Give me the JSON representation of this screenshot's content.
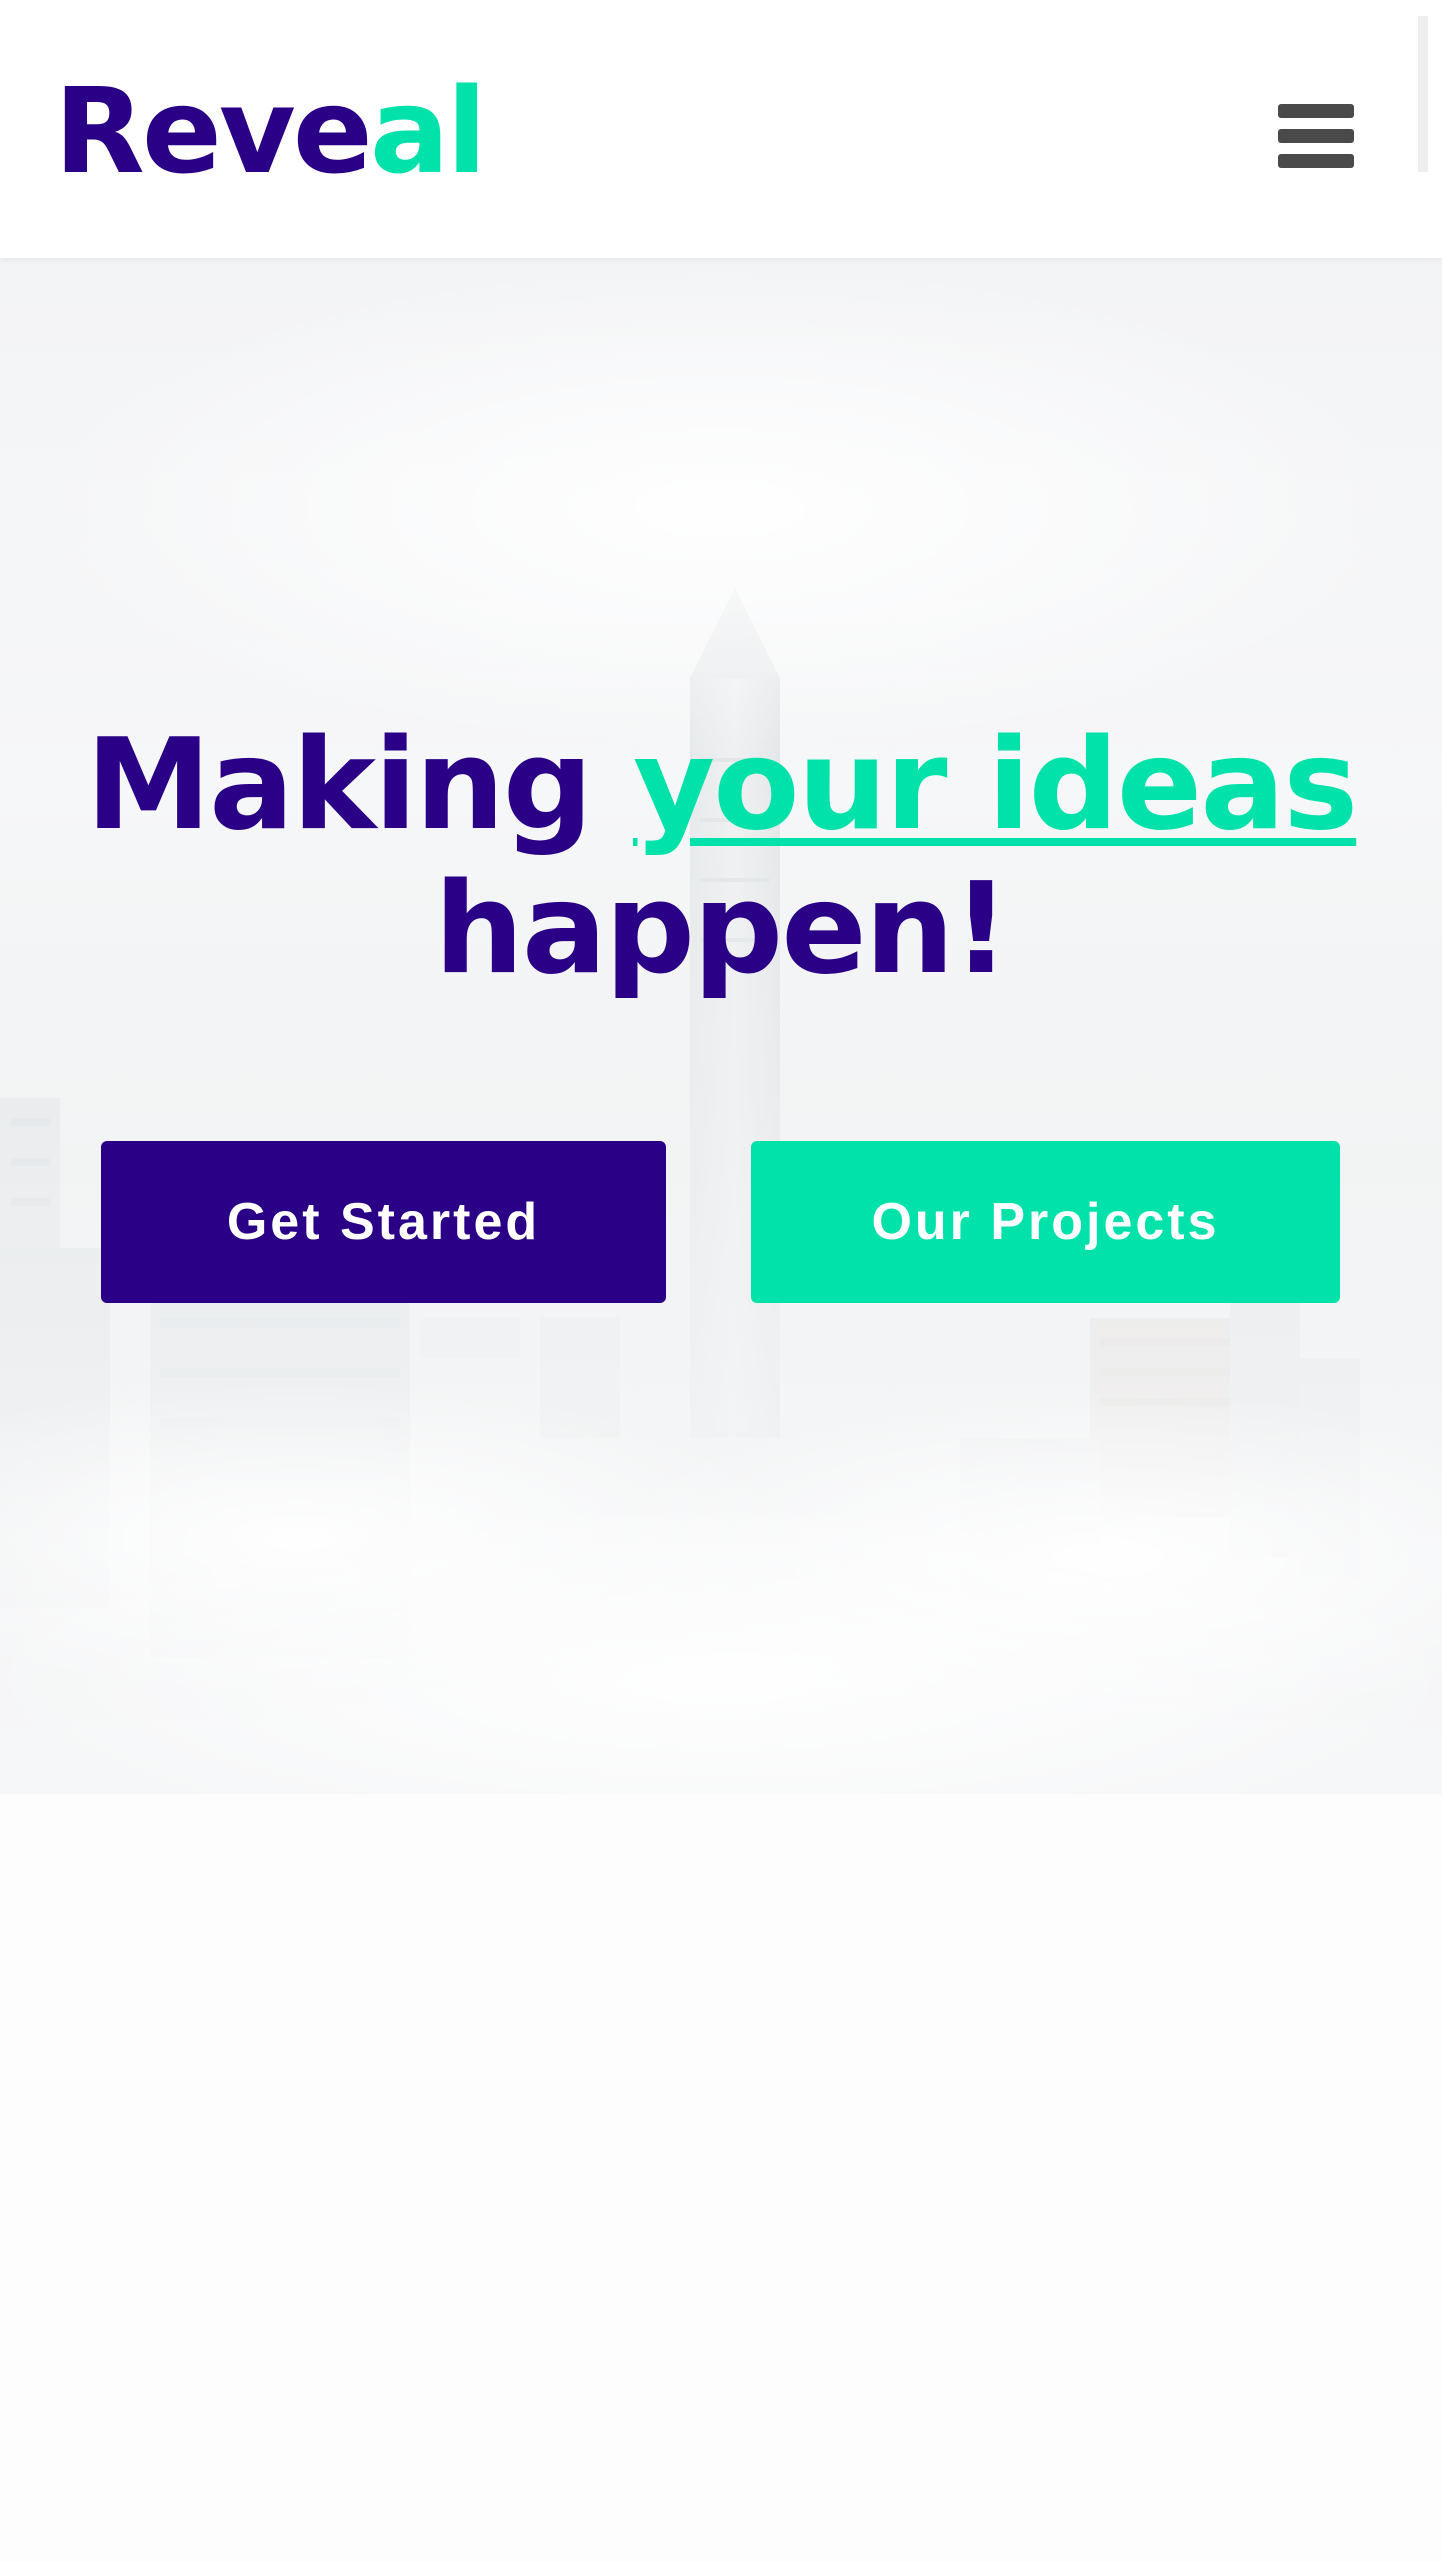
{
  "header": {
    "logo": {
      "part_a": "Reve",
      "part_b": "al"
    },
    "menu_icon": "hamburger-menu-icon"
  },
  "hero": {
    "headline": {
      "lead": "Making",
      "accent": "your ideas",
      "tail": "happen!"
    },
    "background": "misty-city-skyline",
    "buttons": {
      "primary_label": "Get Started",
      "secondary_label": "Our Projects"
    }
  },
  "colors": {
    "primary": "#2a0087",
    "accent": "#00e2aa",
    "menu_icon": "#4a4a4a",
    "background": "#ffffff"
  }
}
